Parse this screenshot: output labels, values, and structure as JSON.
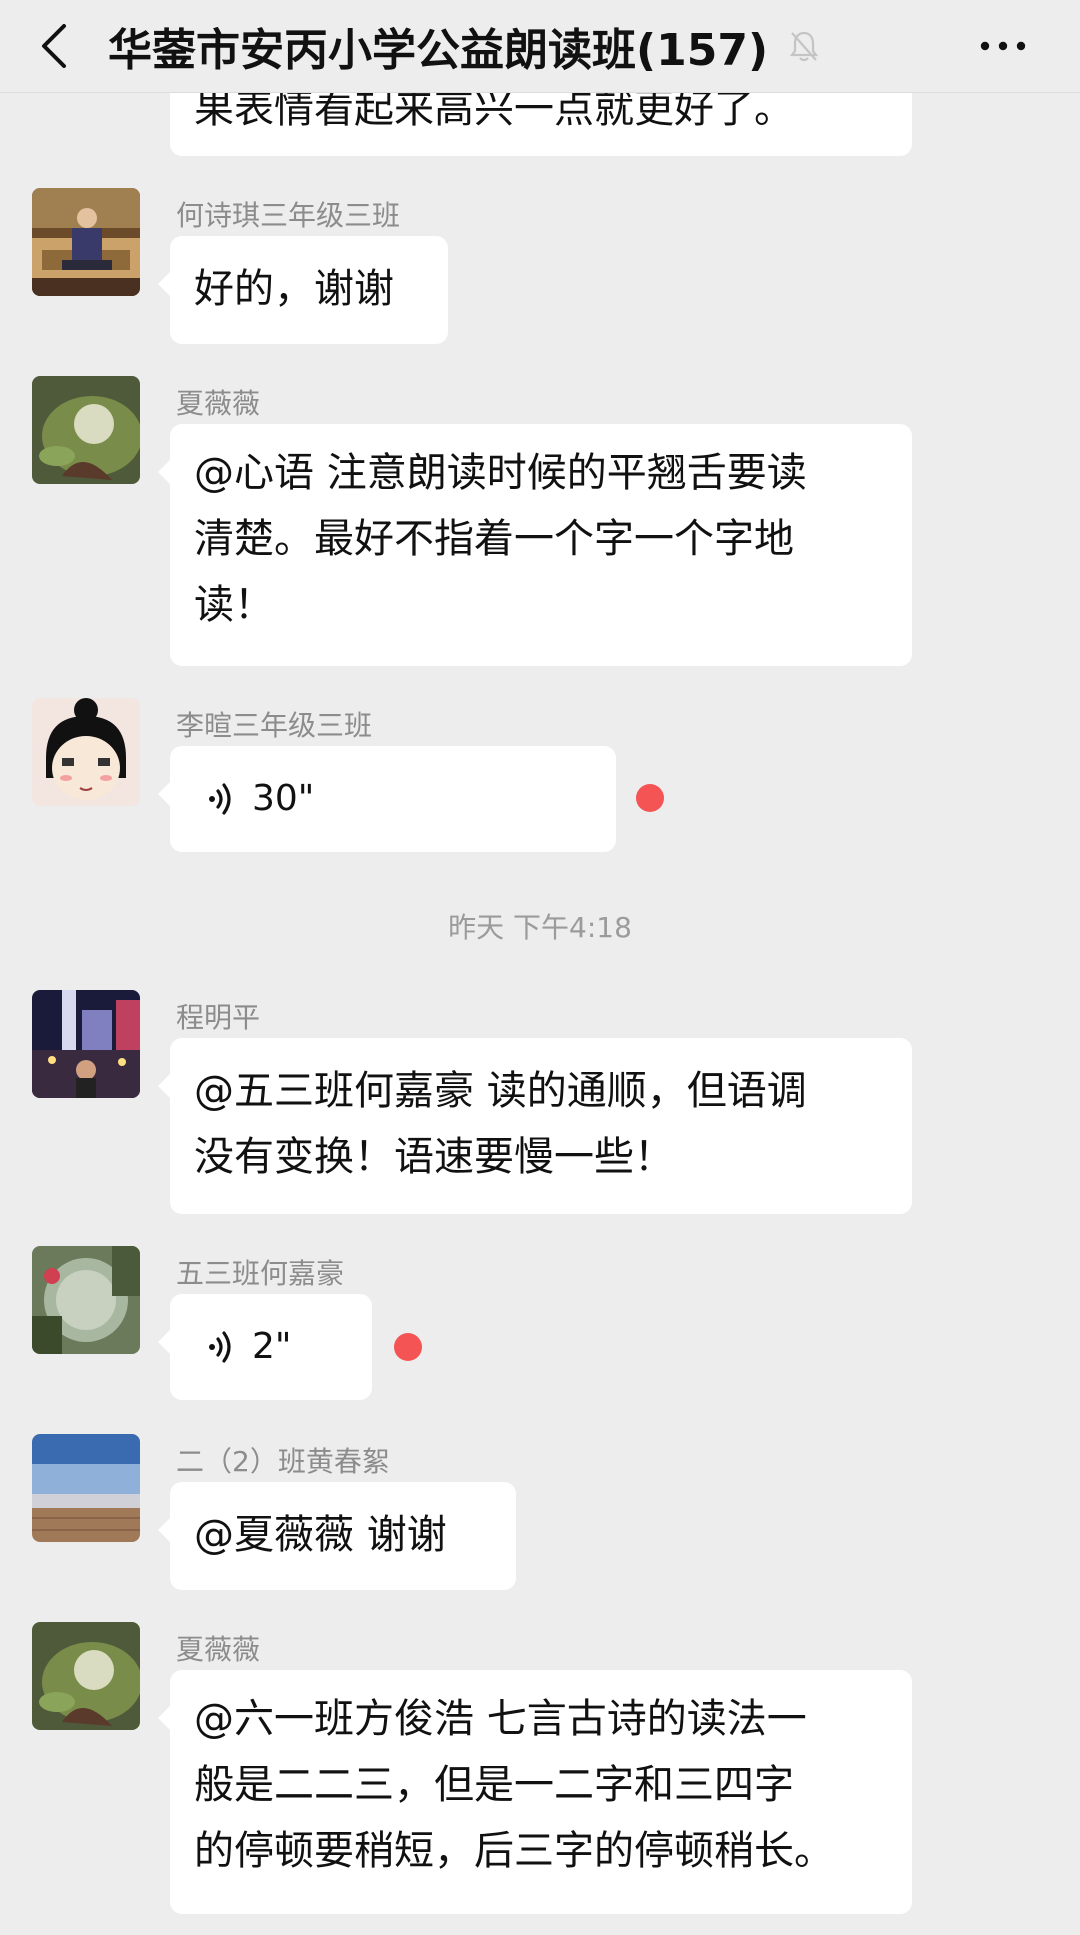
{
  "header": {
    "title": "华蓥市安丙小学公益朗读班(157)"
  },
  "messages": [
    {
      "text": "果表情看起来高兴一点就更好了。"
    },
    {
      "sender": "何诗琪三年级三班",
      "text": "好的，谢谢"
    },
    {
      "sender": "夏薇薇",
      "lines": [
        "@心语 注意朗读时候的平翘舌要读",
        "清楚。最好不指着一个字一个字地",
        "读！"
      ]
    },
    {
      "sender": "李暄三年级三班",
      "voice": "30\""
    },
    {
      "sender": "程明平",
      "lines": [
        "@五三班何嘉豪 读的通顺，但语调",
        "没有变换！语速要慢一些！"
      ]
    },
    {
      "sender": "五三班何嘉豪",
      "voice": "2\""
    },
    {
      "sender": "二（2）班黄春絮",
      "text": "@夏薇薇 谢谢"
    },
    {
      "sender": "夏薇薇",
      "lines": [
        "@六一班方俊浩 七言古诗的读法一",
        "般是二二三，但是一二字和三四字",
        "的停顿要稍短，后三字的停顿稍长。"
      ]
    }
  ],
  "timestamp": "昨天 下午4:18",
  "colors": {
    "background": "#ededed",
    "bubble": "#ffffff",
    "unread": "#f45454"
  }
}
